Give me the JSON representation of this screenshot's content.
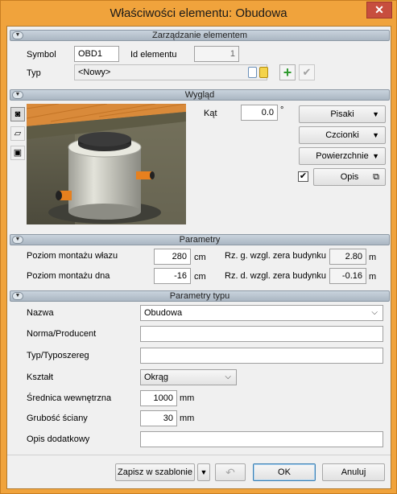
{
  "window": {
    "title": "Właściwości elementu: Obudowa",
    "close_glyph": "✕"
  },
  "sections": {
    "management": "Zarządzanie elementem",
    "appearance": "Wygląd",
    "parameters": "Parametry",
    "type_parameters": "Parametry typu"
  },
  "management": {
    "symbol_label": "Symbol",
    "symbol_value": "OBD1",
    "id_label": "Id elementu",
    "id_value": "1",
    "type_label": "Typ",
    "type_value": "<Nowy>"
  },
  "appearance": {
    "angle_label": "Kąt",
    "angle_value": "0.0",
    "angle_unit": "°",
    "pens_label": "Pisaki",
    "fonts_label": "Czcionki",
    "surfaces_label": "Powierzchnie",
    "description_label": "Opis",
    "description_checked": true
  },
  "parameters": {
    "hatch_level_label": "Poziom montażu włazu",
    "hatch_level_value": "280",
    "hatch_level_unit": "cm",
    "bottom_level_label": "Poziom montażu dna",
    "bottom_level_value": "-16",
    "bottom_level_unit": "cm",
    "top_ord_label": "Rz. g. wzgl. zera budynku",
    "top_ord_value": "2.80",
    "top_ord_unit": "m",
    "bottom_ord_label": "Rz. d. wzgl. zera budynku",
    "bottom_ord_value": "-0.16",
    "bottom_ord_unit": "m"
  },
  "type_parameters": {
    "name_label": "Nazwa",
    "name_value": "Obudowa",
    "standard_label": "Norma/Producent",
    "standard_value": "",
    "series_label": "Typ/Typoszereg",
    "series_value": "",
    "shape_label": "Kształt",
    "shape_value": "Okrąg",
    "diameter_label": "Średnica wewnętrzna",
    "diameter_value": "1000",
    "diameter_unit": "mm",
    "wall_label": "Grubość ściany",
    "wall_value": "30",
    "wall_unit": "mm",
    "extra_label": "Opis dodatkowy",
    "extra_value": ""
  },
  "footer": {
    "save_template_label": "Zapisz w szablonie",
    "ok_label": "OK",
    "cancel_label": "Anuluj"
  }
}
